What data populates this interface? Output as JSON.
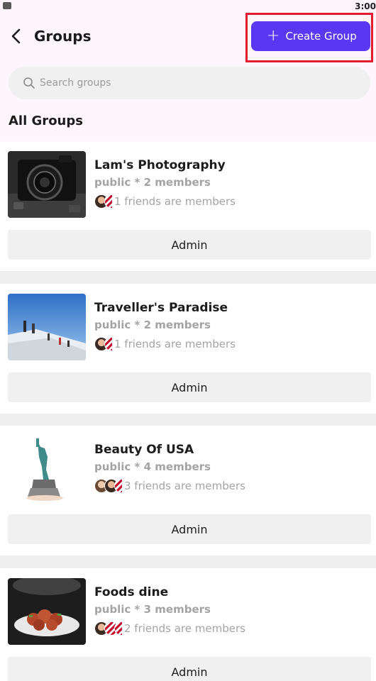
{
  "status_bar": {
    "time": "3:00"
  },
  "header": {
    "title": "Groups",
    "create_label": "Create Group"
  },
  "search": {
    "placeholder": "Search groups"
  },
  "section_title": "All Groups",
  "groups": [
    {
      "name": "Lam's Photography",
      "meta": "public * 2 members",
      "friends": "1 friends are members",
      "action": "Admin"
    },
    {
      "name": "Traveller's Paradise",
      "meta": "public * 2 members",
      "friends": "1 friends are members",
      "action": "Admin"
    },
    {
      "name": "Beauty Of USA",
      "meta": "public * 4 members",
      "friends": "3 friends are members",
      "action": "Admin"
    },
    {
      "name": "Foods dine",
      "meta": "public * 3 members",
      "friends": "2 friends are members",
      "action": "Admin"
    }
  ],
  "colors": {
    "accent": "#5a37f2",
    "highlight": "#e21b2d",
    "header_bg": "#fdf6fd"
  }
}
